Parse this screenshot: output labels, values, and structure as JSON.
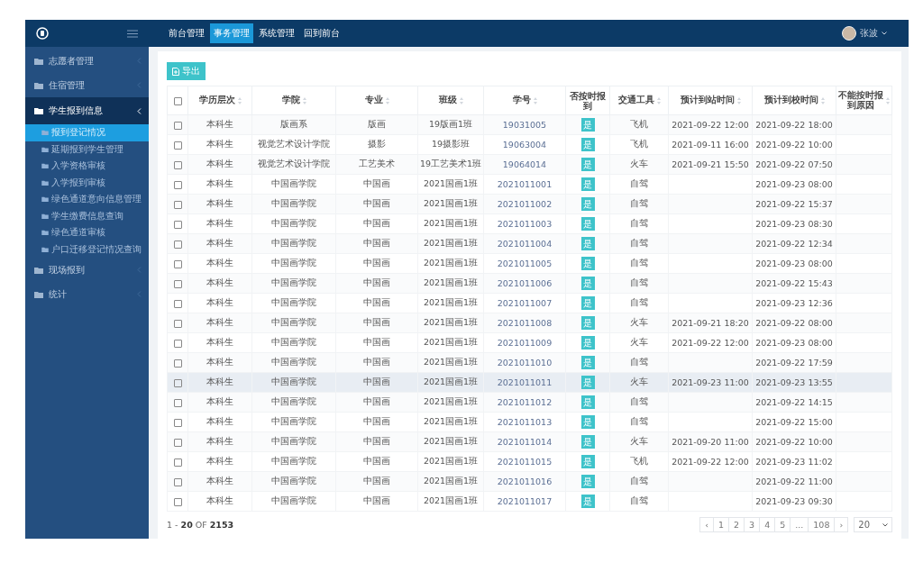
{
  "top_nav": [
    {
      "label": "前台管理",
      "selected": false
    },
    {
      "label": "事务管理",
      "selected": true
    },
    {
      "label": "系统管理",
      "selected": false
    },
    {
      "label": "回到前台",
      "selected": false
    }
  ],
  "user": {
    "name": "张波"
  },
  "sidebar": {
    "items": [
      {
        "label": "志愿者管理",
        "expanded": false
      },
      {
        "label": "住宿管理",
        "expanded": false
      },
      {
        "label": "学生报到信息",
        "expanded": true,
        "children": [
          {
            "label": "报到登记情况",
            "selected": true
          },
          {
            "label": "延期报到学生管理",
            "selected": false
          },
          {
            "label": "入学资格审核",
            "selected": false
          },
          {
            "label": "入学报到审核",
            "selected": false
          },
          {
            "label": "绿色通道意向信息管理",
            "selected": false
          },
          {
            "label": "学生缴费信息查询",
            "selected": false
          },
          {
            "label": "绿色通道审核",
            "selected": false
          },
          {
            "label": "户口迁移登记情况查询",
            "selected": false
          }
        ]
      },
      {
        "label": "现场报到",
        "expanded": false
      },
      {
        "label": "统计",
        "expanded": false
      }
    ]
  },
  "export_button": "导出",
  "table": {
    "all_checked": false,
    "columns": [
      "学历层次",
      "学院",
      "专业",
      "班级",
      "学号",
      "否按时报到",
      "交通工具",
      "预计到站时间",
      "预计到校时间",
      "不能按时报到原因"
    ],
    "rows": [
      {
        "checked": false,
        "highlighted": false,
        "cells": [
          "本科生",
          "版画系",
          "版画",
          "19版画1班",
          "19031005",
          "是",
          "飞机",
          "2021-09-22 12:00",
          "2021-09-22 18:00"
        ]
      },
      {
        "checked": false,
        "highlighted": false,
        "cells": [
          "本科生",
          "视觉艺术设计学院",
          "摄影",
          "19摄影班",
          "19063004",
          "是",
          "飞机",
          "2021-09-11 16:00",
          "2021-09-22 10:00"
        ]
      },
      {
        "checked": false,
        "highlighted": false,
        "cells": [
          "本科生",
          "视觉艺术设计学院",
          "工艺美术",
          "19工艺美术1班",
          "19064014",
          "是",
          "火车",
          "2021-09-21 15:50",
          "2021-09-22 07:50"
        ]
      },
      {
        "checked": false,
        "highlighted": false,
        "cells": [
          "本科生",
          "中国画学院",
          "中国画",
          "2021国画1班",
          "2021011001",
          "是",
          "自驾",
          "",
          "2021-09-23 08:00"
        ]
      },
      {
        "checked": false,
        "highlighted": false,
        "cells": [
          "本科生",
          "中国画学院",
          "中国画",
          "2021国画1班",
          "2021011002",
          "是",
          "自驾",
          "",
          "2021-09-22 15:37"
        ]
      },
      {
        "checked": false,
        "highlighted": false,
        "cells": [
          "本科生",
          "中国画学院",
          "中国画",
          "2021国画1班",
          "2021011003",
          "是",
          "自驾",
          "",
          "2021-09-23 08:30"
        ]
      },
      {
        "checked": false,
        "highlighted": false,
        "cells": [
          "本科生",
          "中国画学院",
          "中国画",
          "2021国画1班",
          "2021011004",
          "是",
          "自驾",
          "",
          "2021-09-22 12:34"
        ]
      },
      {
        "checked": false,
        "highlighted": false,
        "cells": [
          "本科生",
          "中国画学院",
          "中国画",
          "2021国画1班",
          "2021011005",
          "是",
          "自驾",
          "",
          "2021-09-23 08:00"
        ]
      },
      {
        "checked": false,
        "highlighted": false,
        "cells": [
          "本科生",
          "中国画学院",
          "中国画",
          "2021国画1班",
          "2021011006",
          "是",
          "自驾",
          "",
          "2021-09-22 15:43"
        ]
      },
      {
        "checked": false,
        "highlighted": false,
        "cells": [
          "本科生",
          "中国画学院",
          "中国画",
          "2021国画1班",
          "2021011007",
          "是",
          "自驾",
          "",
          "2021-09-23 12:36"
        ]
      },
      {
        "checked": false,
        "highlighted": false,
        "cells": [
          "本科生",
          "中国画学院",
          "中国画",
          "2021国画1班",
          "2021011008",
          "是",
          "火车",
          "2021-09-21 18:20",
          "2021-09-22 08:00"
        ]
      },
      {
        "checked": false,
        "highlighted": false,
        "cells": [
          "本科生",
          "中国画学院",
          "中国画",
          "2021国画1班",
          "2021011009",
          "是",
          "火车",
          "2021-09-22 12:00",
          "2021-09-23 08:00"
        ]
      },
      {
        "checked": false,
        "highlighted": false,
        "cells": [
          "本科生",
          "中国画学院",
          "中国画",
          "2021国画1班",
          "2021011010",
          "是",
          "自驾",
          "",
          "2021-09-22 17:59"
        ]
      },
      {
        "checked": false,
        "highlighted": true,
        "cells": [
          "本科生",
          "中国画学院",
          "中国画",
          "2021国画1班",
          "2021011011",
          "是",
          "火车",
          "2021-09-23 11:00",
          "2021-09-23 13:55"
        ]
      },
      {
        "checked": false,
        "highlighted": false,
        "cells": [
          "本科生",
          "中国画学院",
          "中国画",
          "2021国画1班",
          "2021011012",
          "是",
          "自驾",
          "",
          "2021-09-22 14:15"
        ]
      },
      {
        "checked": false,
        "highlighted": false,
        "cells": [
          "本科生",
          "中国画学院",
          "中国画",
          "2021国画1班",
          "2021011013",
          "是",
          "自驾",
          "",
          "2021-09-22 15:00"
        ]
      },
      {
        "checked": false,
        "highlighted": false,
        "cells": [
          "本科生",
          "中国画学院",
          "中国画",
          "2021国画1班",
          "2021011014",
          "是",
          "火车",
          "2021-09-20 11:00",
          "2021-09-22 10:00"
        ]
      },
      {
        "checked": false,
        "highlighted": false,
        "cells": [
          "本科生",
          "中国画学院",
          "中国画",
          "2021国画1班",
          "2021011015",
          "是",
          "飞机",
          "2021-09-22 12:00",
          "2021-09-23 11:02"
        ]
      },
      {
        "checked": false,
        "highlighted": false,
        "cells": [
          "本科生",
          "中国画学院",
          "中国画",
          "2021国画1班",
          "2021011016",
          "是",
          "自驾",
          "",
          "2021-09-22 11:00"
        ]
      },
      {
        "checked": false,
        "highlighted": false,
        "cells": [
          "本科生",
          "中国画学院",
          "中国画",
          "2021国画1班",
          "2021011017",
          "是",
          "自驾",
          "",
          "2021-09-23 09:30"
        ]
      }
    ]
  },
  "summary": "1 - **20** OF **2153**",
  "pagination": {
    "pages": [
      {
        "label": "1",
        "selected": false
      },
      {
        "label": "2",
        "selected": false
      },
      {
        "label": "3",
        "selected": false
      },
      {
        "label": "4",
        "selected": false
      },
      {
        "label": "5",
        "selected": false
      },
      {
        "label": "...",
        "selected": false
      },
      {
        "label": "108",
        "selected": false
      }
    ],
    "prev": "‹",
    "next": "›",
    "page_size": "20"
  }
}
